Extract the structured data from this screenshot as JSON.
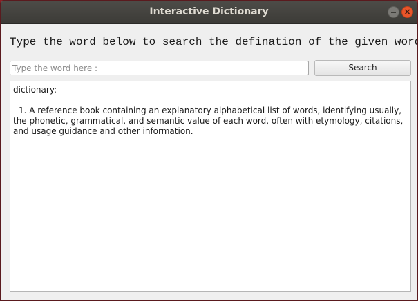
{
  "window": {
    "title": "Interactive Dictionary",
    "minimize_glyph": "",
    "close_glyph": "×"
  },
  "prompt": {
    "text": "Type the word below to search the defination of the given word"
  },
  "search": {
    "value": "",
    "placeholder": "Type the word here :",
    "button_label": "Search"
  },
  "result": {
    "word": "dictionary:",
    "definition": "1. A reference book containing an explanatory alphabetical list of words, identifying usually, the phonetic, grammatical, and semantic value of each word, often with etymology, citations, and usage guidance and other information."
  },
  "colors": {
    "titlebar": "#3c3b37",
    "close_button": "#e9552a",
    "desktop": "#8b1f25",
    "window_bg": "#efefef"
  }
}
